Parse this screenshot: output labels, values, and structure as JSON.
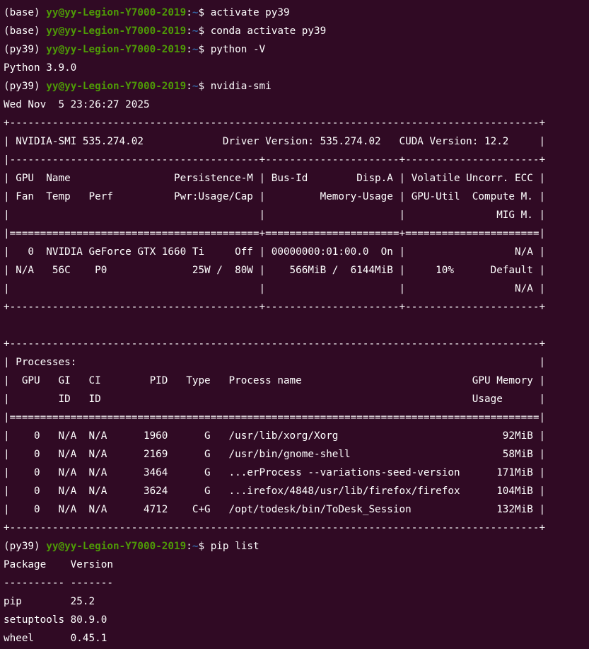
{
  "terminal": {
    "prompt_user": "yy@yy-Legion-Y7000-2019",
    "prompt_path": "~",
    "prompt_suffix": "$ ",
    "colors": {
      "background": "#300a24",
      "text": "#ffffff",
      "user": "#4e9a06",
      "path": "#3465a4"
    },
    "lines": [
      {
        "kind": "prompt",
        "env": "(base) ",
        "cmd": "activate py39"
      },
      {
        "kind": "prompt",
        "env": "(base) ",
        "cmd": "conda activate py39"
      },
      {
        "kind": "prompt",
        "env": "(py39) ",
        "cmd": "python -V"
      },
      {
        "kind": "out",
        "text": "Python 3.9.0"
      },
      {
        "kind": "prompt",
        "env": "(py39) ",
        "cmd": "nvidia-smi"
      },
      {
        "kind": "out",
        "text": "Wed Nov  5 23:26:27 2025"
      },
      {
        "kind": "out",
        "text": "+---------------------------------------------------------------------------------------+"
      },
      {
        "kind": "out",
        "text": "| NVIDIA-SMI 535.274.02             Driver Version: 535.274.02   CUDA Version: 12.2     |"
      },
      {
        "kind": "out",
        "text": "|-----------------------------------------+----------------------+----------------------+"
      },
      {
        "kind": "out",
        "text": "| GPU  Name                 Persistence-M | Bus-Id        Disp.A | Volatile Uncorr. ECC |"
      },
      {
        "kind": "out",
        "text": "| Fan  Temp   Perf          Pwr:Usage/Cap |         Memory-Usage | GPU-Util  Compute M. |"
      },
      {
        "kind": "out",
        "text": "|                                         |                      |               MIG M. |"
      },
      {
        "kind": "out",
        "text": "|=========================================+======================+======================|"
      },
      {
        "kind": "out",
        "text": "|   0  NVIDIA GeForce GTX 1660 Ti     Off | 00000000:01:00.0  On |                  N/A |"
      },
      {
        "kind": "out",
        "text": "| N/A   56C    P0              25W /  80W |    566MiB /  6144MiB |     10%      Default |"
      },
      {
        "kind": "out",
        "text": "|                                         |                      |                  N/A |"
      },
      {
        "kind": "out",
        "text": "+-----------------------------------------+----------------------+----------------------+"
      },
      {
        "kind": "out",
        "text": ""
      },
      {
        "kind": "out",
        "text": "+---------------------------------------------------------------------------------------+"
      },
      {
        "kind": "out",
        "text": "| Processes:                                                                            |"
      },
      {
        "kind": "out",
        "text": "|  GPU   GI   CI        PID   Type   Process name                            GPU Memory |"
      },
      {
        "kind": "out",
        "text": "|        ID   ID                                                             Usage      |"
      },
      {
        "kind": "out",
        "text": "|=======================================================================================|"
      },
      {
        "kind": "out",
        "text": "|    0   N/A  N/A      1960      G   /usr/lib/xorg/Xorg                           92MiB |"
      },
      {
        "kind": "out",
        "text": "|    0   N/A  N/A      2169      G   /usr/bin/gnome-shell                         58MiB |"
      },
      {
        "kind": "out",
        "text": "|    0   N/A  N/A      3464      G   ...erProcess --variations-seed-version      171MiB |"
      },
      {
        "kind": "out",
        "text": "|    0   N/A  N/A      3624      G   ...irefox/4848/usr/lib/firefox/firefox      104MiB |"
      },
      {
        "kind": "out",
        "text": "|    0   N/A  N/A      4712    C+G   /opt/todesk/bin/ToDesk_Session              132MiB |"
      },
      {
        "kind": "out",
        "text": "+---------------------------------------------------------------------------------------+"
      },
      {
        "kind": "prompt",
        "env": "(py39) ",
        "cmd": "pip list"
      },
      {
        "kind": "out",
        "text": "Package    Version"
      },
      {
        "kind": "out",
        "text": "---------- -------"
      },
      {
        "kind": "out",
        "text": "pip        25.2"
      },
      {
        "kind": "out",
        "text": "setuptools 80.9.0"
      },
      {
        "kind": "out",
        "text": "wheel      0.45.1"
      }
    ]
  }
}
